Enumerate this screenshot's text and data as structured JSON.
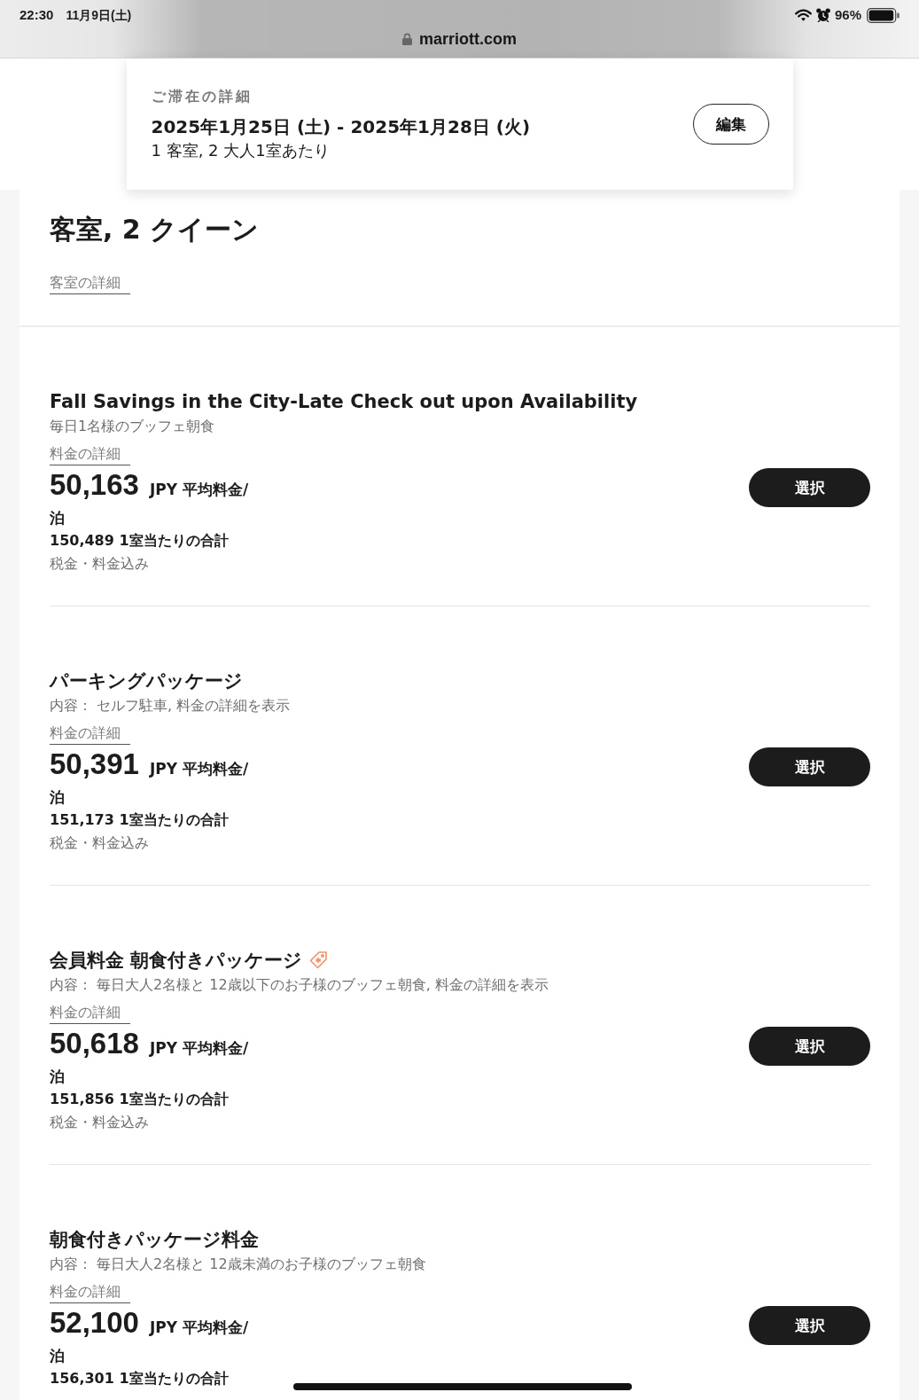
{
  "status_bar": {
    "time": "22:30",
    "date": "11月9日(土)",
    "battery": "96%",
    "url": "marriott.com"
  },
  "stay_details": {
    "label": "ご滞在の詳細",
    "dates": "2025年1月25日 (土) - 2025年1月28日 (火)",
    "guests": "1 客室, 2 大人1室あたり",
    "edit_button": "編集"
  },
  "room": {
    "title": "客室, 2 クイーン",
    "details_link": "客室の詳細"
  },
  "rates": [
    {
      "title": "Fall Savings in the City-Late Check out upon Availability",
      "tag_icon": false,
      "description": "毎日1名様のブッフェ朝食",
      "details_link": "料金の詳細",
      "price": "50,163",
      "unit_lines": [
        "JPY 平均料金/",
        "泊"
      ],
      "total": "150,489 1室当たりの合計",
      "tax_note": "税金・料金込み",
      "button": "選択"
    },
    {
      "title": "パーキングパッケージ",
      "tag_icon": false,
      "description": "内容： セルフ駐車, 料金の詳細を表示",
      "details_link": "料金の詳細",
      "price": "50,391",
      "unit_lines": [
        "JPY 平均料金/",
        "泊"
      ],
      "total": "151,173 1室当たりの合計",
      "tax_note": "税金・料金込み",
      "button": "選択"
    },
    {
      "title": "会員料金 朝食付きパッケージ",
      "tag_icon": true,
      "description": "内容： 毎日大人2名様と 12歳以下のお子様のブッフェ朝食, 料金の詳細を表示",
      "details_link": "料金の詳細",
      "price": "50,618",
      "unit_lines": [
        "JPY 平均料金/",
        "泊"
      ],
      "total": "151,856 1室当たりの合計",
      "tax_note": "税金・料金込み",
      "button": "選択"
    },
    {
      "title": "朝食付きパッケージ料金",
      "tag_icon": false,
      "description": "内容： 毎日大人2名様と 12歳未満のお子様のブッフェ朝食",
      "details_link": "料金の詳細",
      "price": "52,100",
      "unit_lines": [
        "JPY 平均料金/",
        "泊"
      ],
      "total": "156,301 1室当たりの合計",
      "button": "選択"
    }
  ]
}
